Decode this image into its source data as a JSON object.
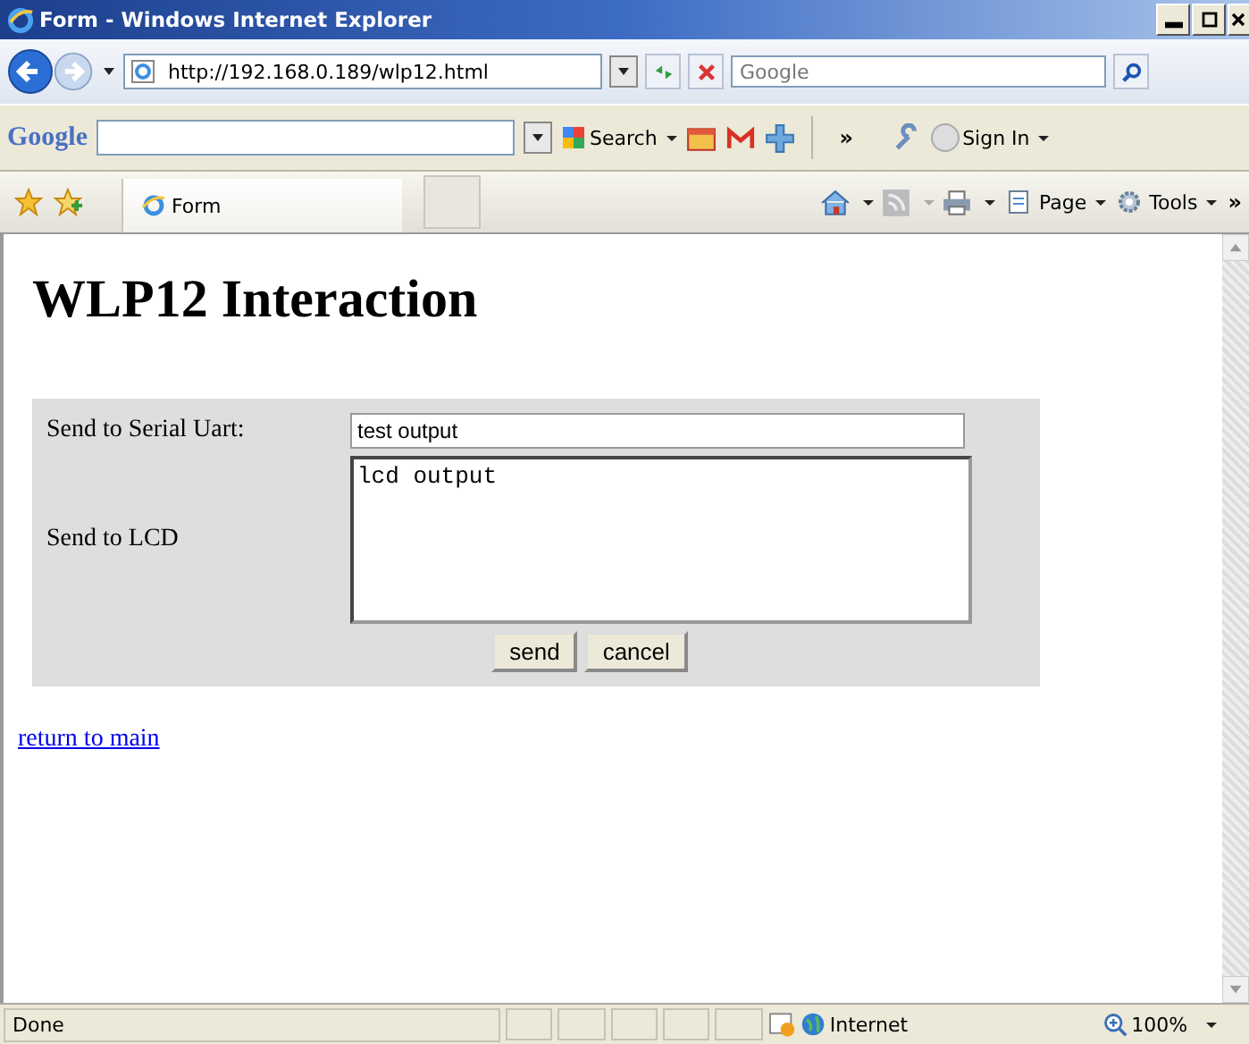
{
  "window": {
    "title": "Form - Windows Internet Explorer"
  },
  "address_bar": {
    "url": "http://192.168.0.189/wlp12.html"
  },
  "search": {
    "placeholder": "Google"
  },
  "google_toolbar": {
    "logo": "Google",
    "search_label": "Search",
    "more": "»",
    "sign_in": "Sign In"
  },
  "tabs": [
    {
      "label": "Form",
      "selected": true
    }
  ],
  "command_bar": {
    "page": "Page",
    "tools": "Tools",
    "more": "»"
  },
  "page": {
    "heading": "WLP12 Interaction",
    "fields": [
      {
        "kind": "input",
        "label": "Send to Serial Uart:",
        "value": "test output"
      },
      {
        "kind": "textarea",
        "label": "Send to LCD",
        "value": "lcd output"
      }
    ],
    "buttons": [
      "send",
      "cancel"
    ],
    "link": "return to main"
  },
  "status_bar": {
    "text": "Done",
    "zone": "Internet",
    "zoom": "100%"
  }
}
